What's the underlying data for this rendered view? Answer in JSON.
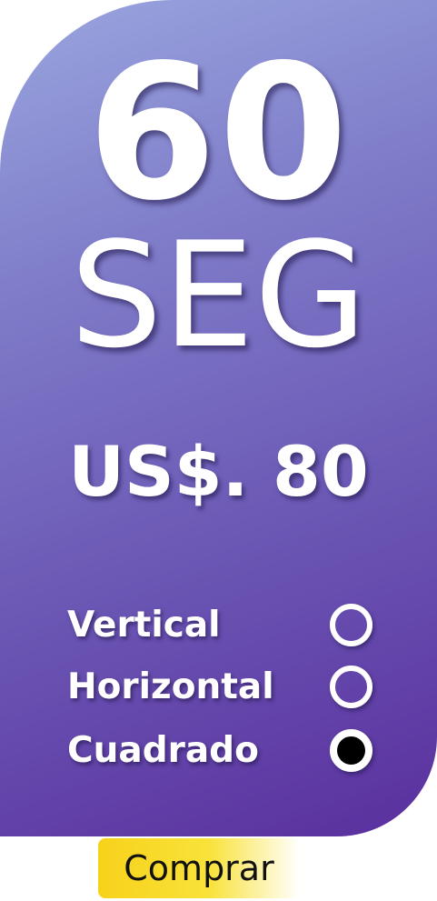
{
  "plan": {
    "duration_value": "60",
    "duration_unit": "SEG",
    "price": "US$. 80"
  },
  "format_options": [
    {
      "label": "Vertical",
      "selected": false
    },
    {
      "label": "Horizontal",
      "selected": false
    },
    {
      "label": "Cuadrado",
      "selected": true
    }
  ],
  "buy_button": {
    "label": "Comprar"
  },
  "colors": {
    "card_gradient_start": "#9aa6df",
    "card_gradient_end": "#5a2f9e",
    "button_yellow": "#f7d21a",
    "text": "#ffffff"
  }
}
